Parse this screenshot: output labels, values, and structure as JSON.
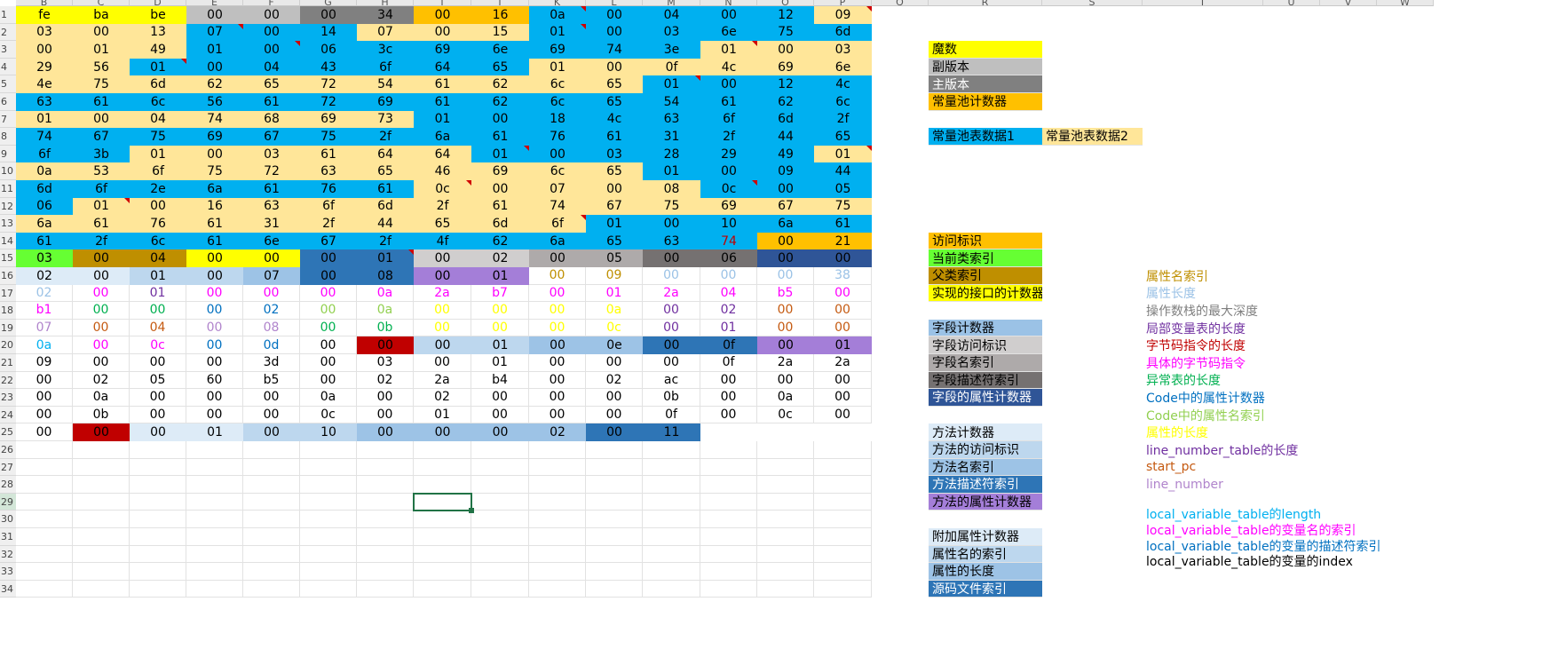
{
  "columns": [
    "B",
    "C",
    "D",
    "E",
    "F",
    "G",
    "H",
    "I",
    "J",
    "K",
    "L",
    "M",
    "N",
    "O",
    "P",
    "Q",
    "R",
    "S",
    "T",
    "U",
    "V",
    "W"
  ],
  "row_numbers": [
    "1",
    "2",
    "3",
    "4",
    "5",
    "6",
    "7",
    "8",
    "9",
    "10",
    "11",
    "12",
    "13",
    "14",
    "15",
    "16",
    "17",
    "18",
    "19",
    "20",
    "21",
    "22",
    "23",
    "24",
    "25",
    "26",
    "27",
    "28",
    "29",
    "30",
    "31",
    "32",
    "33",
    "34"
  ],
  "colors": {
    "magic": "#ffff00",
    "minor": "#bfbfbf",
    "major": "#808080",
    "cp_count": "#ffc000",
    "cp_data1": "#00b0f0",
    "cp_data2": "#ffe699",
    "access": "#ffc000",
    "this_class": "#66ff33",
    "super_class": "#bf8f00",
    "iface_count": "#ffff00",
    "field_count": "#9bc2e6",
    "field_access": "#d0cece",
    "field_name": "#aeaaaa",
    "field_desc": "#757171",
    "field_attr_count": "#2f5597",
    "method_count": "#ddebf7",
    "method_access": "#bdd7ee",
    "method_name": "#9dc3e6",
    "method_desc": "#2e75b6",
    "method_attr_count": "#a47ed8",
    "extra_attr_count": "#ddebf7",
    "attr_name_idx": "#bdd7ee",
    "attr_len": "#9dc3e6",
    "src_idx": "#2e75b6",
    "red": "#c00000"
  },
  "hex_rows": [
    [
      "fe",
      "ba",
      "be",
      "00",
      "00",
      "00",
      "34",
      "00",
      "16",
      "0a",
      "00",
      "04",
      "00",
      "12",
      "09"
    ],
    [
      "03",
      "00",
      "13",
      "07",
      "00",
      "14",
      "07",
      "00",
      "15",
      "01",
      "00",
      "03",
      "6e",
      "75",
      "6d"
    ],
    [
      "00",
      "01",
      "49",
      "01",
      "00",
      "06",
      "3c",
      "69",
      "6e",
      "69",
      "74",
      "3e",
      "01",
      "00",
      "03"
    ],
    [
      "29",
      "56",
      "01",
      "00",
      "04",
      "43",
      "6f",
      "64",
      "65",
      "01",
      "00",
      "0f",
      "4c",
      "69",
      "6e"
    ],
    [
      "4e",
      "75",
      "6d",
      "62",
      "65",
      "72",
      "54",
      "61",
      "62",
      "6c",
      "65",
      "01",
      "00",
      "12",
      "4c"
    ],
    [
      "63",
      "61",
      "6c",
      "56",
      "61",
      "72",
      "69",
      "61",
      "62",
      "6c",
      "65",
      "54",
      "61",
      "62",
      "6c"
    ],
    [
      "01",
      "00",
      "04",
      "74",
      "68",
      "69",
      "73",
      "01",
      "00",
      "18",
      "4c",
      "63",
      "6f",
      "6d",
      "2f"
    ],
    [
      "74",
      "67",
      "75",
      "69",
      "67",
      "75",
      "2f",
      "6a",
      "61",
      "76",
      "61",
      "31",
      "2f",
      "44",
      "65"
    ],
    [
      "6f",
      "3b",
      "01",
      "00",
      "03",
      "61",
      "64",
      "64",
      "01",
      "00",
      "03",
      "28",
      "29",
      "49",
      "01"
    ],
    [
      "0a",
      "53",
      "6f",
      "75",
      "72",
      "63",
      "65",
      "46",
      "69",
      "6c",
      "65",
      "01",
      "00",
      "09",
      "44"
    ],
    [
      "6d",
      "6f",
      "2e",
      "6a",
      "61",
      "76",
      "61",
      "0c",
      "00",
      "07",
      "00",
      "08",
      "0c",
      "00",
      "05"
    ],
    [
      "06",
      "01",
      "00",
      "16",
      "63",
      "6f",
      "6d",
      "2f",
      "61",
      "74",
      "67",
      "75",
      "69",
      "67",
      "75"
    ],
    [
      "6a",
      "61",
      "76",
      "61",
      "31",
      "2f",
      "44",
      "65",
      "6d",
      "6f",
      "01",
      "00",
      "10",
      "6a",
      "61"
    ],
    [
      "61",
      "2f",
      "6c",
      "61",
      "6e",
      "67",
      "2f",
      "4f",
      "62",
      "6a",
      "65",
      "63",
      "74",
      "00",
      "21"
    ],
    [
      "03",
      "00",
      "04",
      "00",
      "00",
      "00",
      "01",
      "00",
      "02",
      "00",
      "05",
      "00",
      "06",
      "00",
      "00"
    ],
    [
      "02",
      "00",
      "01",
      "00",
      "07",
      "00",
      "08",
      "00",
      "01",
      "00",
      "09",
      "00",
      "00",
      "00",
      "38"
    ],
    [
      "02",
      "00",
      "01",
      "00",
      "00",
      "00",
      "0a",
      "2a",
      "b7",
      "00",
      "01",
      "2a",
      "04",
      "b5",
      "00"
    ],
    [
      "b1",
      "00",
      "00",
      "00",
      "02",
      "00",
      "0a",
      "00",
      "00",
      "00",
      "0a",
      "00",
      "02",
      "00",
      "00"
    ],
    [
      "07",
      "00",
      "04",
      "00",
      "08",
      "00",
      "0b",
      "00",
      "00",
      "00",
      "0c",
      "00",
      "01",
      "00",
      "00"
    ],
    [
      "0a",
      "00",
      "0c",
      "00",
      "0d",
      "00",
      "00",
      "00",
      "01",
      "00",
      "0e",
      "00",
      "0f",
      "00",
      "01"
    ],
    [
      "09",
      "00",
      "00",
      "00",
      "3d",
      "00",
      "03",
      "00",
      "01",
      "00",
      "00",
      "00",
      "0f",
      "2a",
      "2a"
    ],
    [
      "00",
      "02",
      "05",
      "60",
      "b5",
      "00",
      "02",
      "2a",
      "b4",
      "00",
      "02",
      "ac",
      "00",
      "00",
      "00"
    ],
    [
      "00",
      "0a",
      "00",
      "00",
      "00",
      "0a",
      "00",
      "02",
      "00",
      "00",
      "00",
      "0b",
      "00",
      "0a",
      "00"
    ],
    [
      "00",
      "0b",
      "00",
      "00",
      "00",
      "0c",
      "00",
      "01",
      "00",
      "00",
      "00",
      "0f",
      "00",
      "0c",
      "00"
    ],
    [
      "00",
      "00",
      "00",
      "01",
      "00",
      "10",
      "00",
      "00",
      "00",
      "02",
      "00",
      "11"
    ]
  ],
  "legend": {
    "magic": "魔数",
    "minor": "副版本",
    "major": "主版本",
    "cp_count": "常量池计数器",
    "cp_data1": "常量池表数据1",
    "cp_data2": "常量池表数据2",
    "access": "访问标识",
    "this_class": "当前类索引",
    "super_class": "父类索引",
    "iface_count": "实现的接口的计数器",
    "field_count": "字段计数器",
    "field_access": "字段访问标识",
    "field_name": "字段名索引",
    "field_desc": "字段描述符索引",
    "field_attr_count": "字段的属性计数器",
    "method_count": "方法计数器",
    "method_access": "方法的访问标识",
    "method_name": "方法名索引",
    "method_desc": "方法描述符索引",
    "method_attr_count": "方法的属性计数器",
    "extra_attr_count": "附加属性计数器",
    "attr_name_idx": "属性名的索引",
    "attr_len": "属性的长度",
    "src_idx": "源码文件索引"
  },
  "descriptions": [
    {
      "text": "属性名索引",
      "color": "#bf8f00"
    },
    {
      "text": "属性长度",
      "color": "#9bc2e6"
    },
    {
      "text": "操作数栈的最大深度",
      "color": "#7f7f7f"
    },
    {
      "text": "局部变量表的长度",
      "color": "#7030a0"
    },
    {
      "text": "字节码指令的长度",
      "color": "#c00000"
    },
    {
      "text": "具体的字节码指令",
      "color": "#ff00ff"
    },
    {
      "text": "异常表的长度",
      "color": "#00b050"
    },
    {
      "text": "Code中的属性计数器",
      "color": "#0070c0"
    },
    {
      "text": "Code中的属性名索引",
      "color": "#92d050"
    },
    {
      "text": "属性的长度",
      "color": "#ffff00"
    },
    {
      "text": "line_number_table的长度",
      "color": "#7030a0"
    },
    {
      "text": "start_pc",
      "color": "#c55a11"
    },
    {
      "text": "line_number",
      "color": "#b084cc"
    },
    {
      "text": "local_variable_table的length",
      "color": "#00b0f0"
    },
    {
      "text": "local_variable_table的变量名的索引",
      "color": "#ff00ff"
    },
    {
      "text": "local_variable_table的变量的描述符索引",
      "color": "#0070c0"
    },
    {
      "text": "local_variable_table的变量的index",
      "color": "#000000"
    }
  ]
}
